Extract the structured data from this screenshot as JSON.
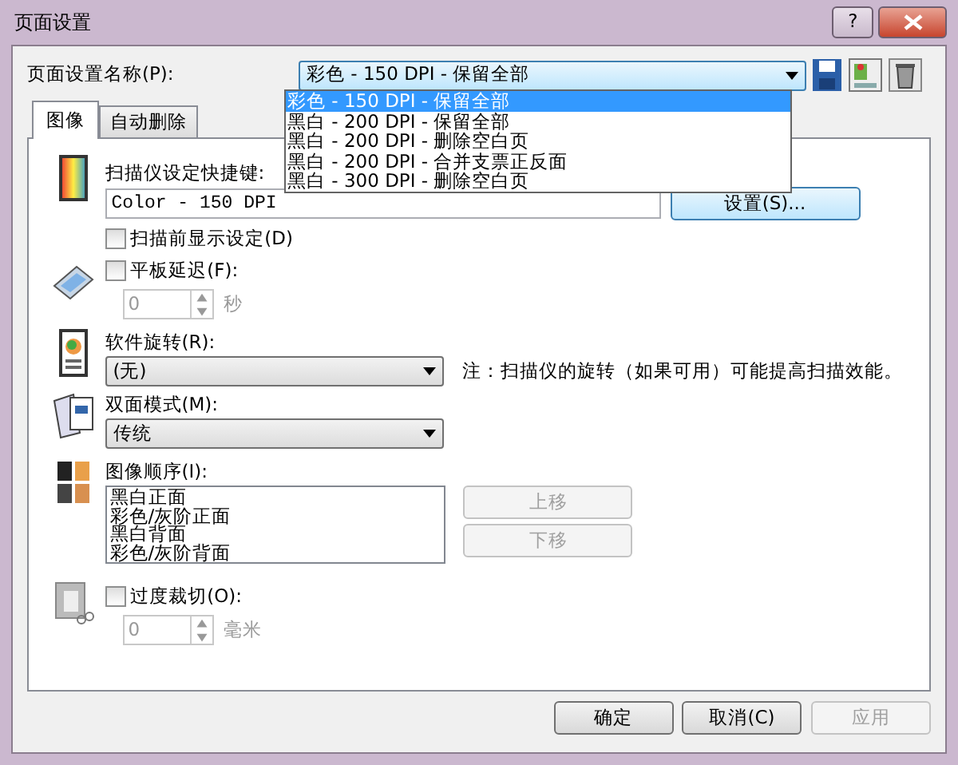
{
  "window": {
    "title": "页面设置",
    "help": "?"
  },
  "profile": {
    "label": "页面设置名称(P):",
    "value": "彩色 - 150 DPI - 保留全部",
    "options": [
      {
        "text": "彩色 - 150 DPI - 保留全部",
        "selected": true
      },
      {
        "text": "黑白 - 200 DPI - 保留全部",
        "selected": false
      },
      {
        "text": "黑白 - 200 DPI - 删除空白页",
        "selected": false
      },
      {
        "text": "黑白 - 200 DPI - 合并支票正反面",
        "selected": false
      },
      {
        "text": "黑白 - 300 DPI - 删除空白页",
        "selected": false
      }
    ]
  },
  "tabs": [
    {
      "label": "图像",
      "selected": true
    },
    {
      "label": "自动删除",
      "selected": false
    }
  ],
  "shortcut": {
    "label": "扫描仪设定快捷键:",
    "value": "Color - 150 DPI",
    "button": "设置(S)..."
  },
  "show_settings": {
    "label": "扫描前显示设定(D)",
    "checked": false
  },
  "flatbed_delay": {
    "label": "平板延迟(F):",
    "checked": false,
    "value": "0",
    "unit": "秒",
    "disabled": true
  },
  "rotation": {
    "label": "软件旋转(R):",
    "value": "(无)",
    "note": "注：扫描仪的旋转（如果可用）可能提高扫描效能。"
  },
  "duplex": {
    "label": "双面模式(M):",
    "value": "传统"
  },
  "image_order": {
    "label": "图像顺序(I):",
    "items": [
      "黑白正面",
      "彩色/灰阶正面",
      "黑白背面",
      "彩色/灰阶背面"
    ],
    "buttons": [
      {
        "label": "上移",
        "disabled": true
      },
      {
        "label": "下移",
        "disabled": true
      }
    ]
  },
  "overscan": {
    "label": "过度裁切(O):",
    "checked": false,
    "value": "0",
    "unit": "毫米",
    "disabled": true
  },
  "buttons": [
    {
      "label": "确定",
      "disabled": false
    },
    {
      "label": "取消(C)",
      "disabled": false
    },
    {
      "label": "应用",
      "disabled": true
    }
  ]
}
